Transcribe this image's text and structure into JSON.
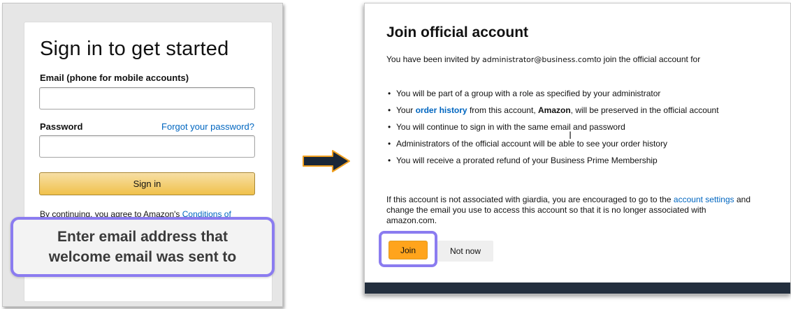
{
  "signin": {
    "title": "Sign in to get started",
    "email_label": "Email (phone for mobile accounts)",
    "email_value": "",
    "password_label": "Password",
    "forgot_link": "Forgot your password?",
    "password_value": "",
    "button_label": "Sign in",
    "legal_prefix": "By continuing, you agree to Amazon's ",
    "legal_link": "Conditions of"
  },
  "callout_left": {
    "line1": "Enter email address that",
    "line2": "welcome email was sent to"
  },
  "join": {
    "title": "Join official account",
    "invite_prefix": "You have been invited by ",
    "invite_email": "administrator@business.com",
    "invite_suffix": "to join the official account for",
    "bullets": {
      "b1": "You will be part of a group with a role as specified by your administrator",
      "b2_prefix": "Your ",
      "b2_link": "order history",
      "b2_middle": " from this account, ",
      "b2_bold": "Amazon",
      "b2_suffix": ", will be preserved in the official account",
      "b3": "You will continue to sign in with the same email and password",
      "b4": "Administrators of the official account will be able to see your order history",
      "b5": "You will receive a prorated refund of your Business Prime Membership"
    },
    "footer_prefix": "If this account is not associated with giardia, you are encouraged to go to the ",
    "footer_link": "account settings",
    "footer_suffix": " and change the email you use to access this account so that it is no longer associated with amazon.com.",
    "join_button": "Join",
    "not_now_button": "Not now"
  },
  "colors": {
    "callout_border": "#8b7cf0",
    "signin_button": "#f0c14b",
    "join_button": "#ffa41c",
    "link": "#0066c0",
    "arrow_fill": "#1a2738",
    "arrow_outline": "#f0a020",
    "bottom_bar": "#232f3e"
  }
}
